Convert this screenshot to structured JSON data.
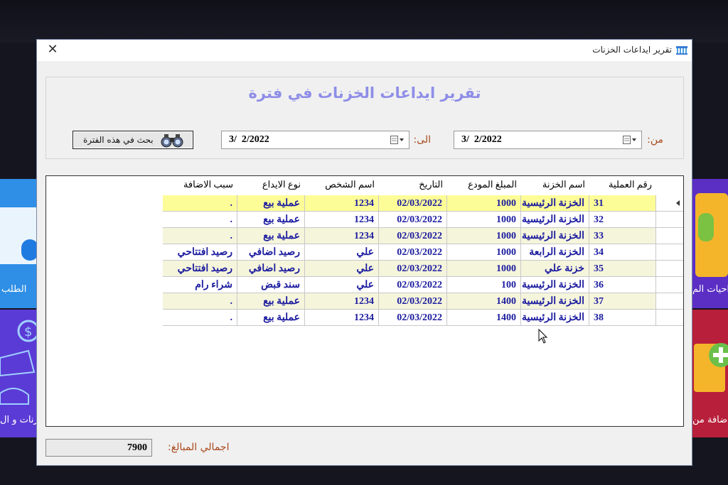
{
  "window": {
    "title": "تقرير ايداعات الخزنات",
    "close_glyph": "✕"
  },
  "report": {
    "title": "تقرير ايداعات الخزنات في فترة",
    "from_label": "من:",
    "to_label": "الى:",
    "from_date": "3/  2/2022",
    "to_date": "3/  2/2022",
    "search_button": "بحث في هذه الفترة"
  },
  "grid": {
    "columns": [
      "رقم العملية",
      "اسم الخزنة",
      "المبلغ المودع",
      "التاريخ",
      "اسم الشخص",
      "نوع الايداع",
      "سبب الاضافة"
    ],
    "rows": [
      {
        "id": "31",
        "safe": "الخزنة الرئيسية",
        "amount": "1000",
        "date": "02/03/2022",
        "person": "1234",
        "type": "عملية بيع",
        "reason": "."
      },
      {
        "id": "32",
        "safe": "الخزنة الرئيسية",
        "amount": "1000",
        "date": "02/03/2022",
        "person": "1234",
        "type": "عملية بيع",
        "reason": "."
      },
      {
        "id": "33",
        "safe": "الخزنة الرئيسية",
        "amount": "1000",
        "date": "02/03/2022",
        "person": "1234",
        "type": "عملية بيع",
        "reason": "."
      },
      {
        "id": "34",
        "safe": "الخزنة الرابعة",
        "amount": "1000",
        "date": "02/03/2022",
        "person": "علي",
        "type": "رصيد اضافي",
        "reason": "رصيد افتتاحي"
      },
      {
        "id": "35",
        "safe": "خزنة علي",
        "amount": "1000",
        "date": "02/03/2022",
        "person": "علي",
        "type": "رصيد اضافي",
        "reason": "رصيد افتتاحي"
      },
      {
        "id": "36",
        "safe": "الخزنة الرئيسية",
        "amount": "100",
        "date": "02/03/2022",
        "person": "علي",
        "type": "سند قبض",
        "reason": "شراء رام"
      },
      {
        "id": "37",
        "safe": "الخزنة الرئيسية",
        "amount": "1400",
        "date": "02/03/2022",
        "person": "1234",
        "type": "عملية بيع",
        "reason": "."
      },
      {
        "id": "38",
        "safe": "الخزنة الرئيسية",
        "amount": "1400",
        "date": "02/03/2022",
        "person": "1234",
        "type": "عملية بيع",
        "reason": "."
      }
    ],
    "selected_row": 0
  },
  "footer": {
    "total_label": "اجمالي المبالغ:",
    "total_value": "7900"
  },
  "background": {
    "left_tile_top_label": "الطلب",
    "left_tile_bottom_label": "زنات و ال",
    "right_tile_top_label": "احيات الم",
    "right_tile_bottom_label": "اضافة من"
  },
  "colors": {
    "title_color": "#8e8ee8",
    "label_color": "#a8481a",
    "cell_text": "#1c1ca0",
    "row_odd": "#f5f5dc",
    "row_selected": "#fdfd98",
    "id_col": "#f5f5dc"
  }
}
